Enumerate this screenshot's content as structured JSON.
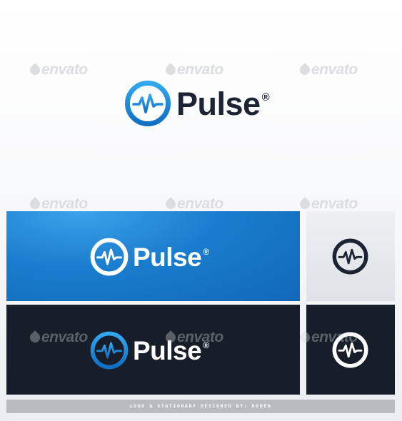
{
  "brand": {
    "name": "Pulse",
    "registered_mark": "®"
  },
  "watermark": {
    "text": "envato"
  },
  "footer": {
    "credit": "LOGO & STATIONARY DESIGNED BY: RODEN"
  },
  "colors": {
    "brand_blue": "#1a86d8",
    "dark_navy": "#1c2433",
    "panel_blue": "#1670c4",
    "panel_dark": "#171e2a",
    "panel_light": "#e6e8eb"
  },
  "icons": {
    "logo_mark": "pulse-circle-icon",
    "watermark_mark": "envato-leaf-icon"
  }
}
